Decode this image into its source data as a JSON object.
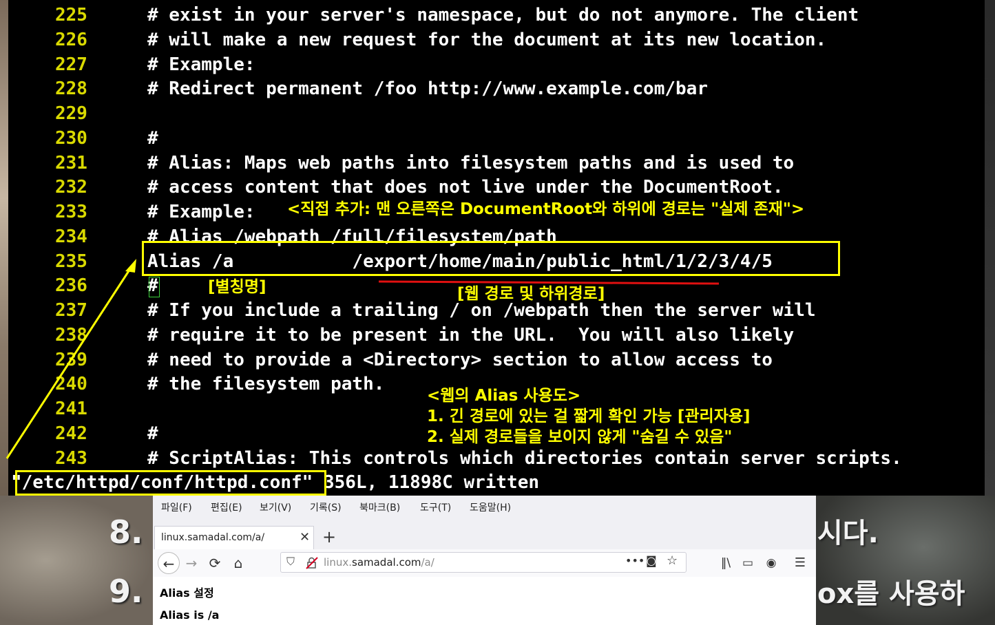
{
  "terminal": {
    "lines": [
      {
        "no": "225",
        "text": "# exist in your server's namespace, but do not anymore. The client"
      },
      {
        "no": "226",
        "text": "# will make a new request for the document at its new location."
      },
      {
        "no": "227",
        "text": "# Example:"
      },
      {
        "no": "228",
        "text": "# Redirect permanent /foo http://www.example.com/bar"
      },
      {
        "no": "229",
        "text": ""
      },
      {
        "no": "230",
        "text": "#"
      },
      {
        "no": "231",
        "text": "# Alias: Maps web paths into filesystem paths and is used to"
      },
      {
        "no": "232",
        "text": "# access content that does not live under the DocumentRoot."
      },
      {
        "no": "233",
        "text": "# Example:"
      },
      {
        "no": "234",
        "text": "# Alias /webpath /full/filesystem/path"
      },
      {
        "no": "235",
        "text": "Alias /a           /export/home/main/public_html/1/2/3/4/5"
      },
      {
        "no": "236",
        "text": "#"
      },
      {
        "no": "237",
        "text": "# If you include a trailing / on /webpath then the server will"
      },
      {
        "no": "238",
        "text": "# require it to be present in the URL.  You will also likely"
      },
      {
        "no": "239",
        "text": "# need to provide a <Directory> section to allow access to"
      },
      {
        "no": "240",
        "text": "# the filesystem path."
      },
      {
        "no": "241",
        "text": ""
      },
      {
        "no": "242",
        "text": "#"
      },
      {
        "no": "243",
        "text": "# ScriptAlias: This controls which directories contain server scripts."
      }
    ],
    "status": "\"/etc/httpd/conf/httpd.conf\" 356L, 11898C written"
  },
  "annotations": {
    "note_233": "<직접 추가: 맨 오른쪽은 DocumentRoot와 하위에 경로는 \"실제 존재\">",
    "alias_label": "[별칭명]",
    "path_label": "[웹 경로 및 하위경로]",
    "usage_title": "<웹의 Alias 사용도>",
    "usage_1": "1. 긴 경로에 있는 걸 짧게 확인 가능 [관리자용]",
    "usage_2": "2. 실제 경로들을 보이지 않게 \"숨길 수 있음\""
  },
  "background": {
    "num_8": "8.",
    "num_9": "9.",
    "right_text_1": "시다.",
    "right_text_2": "ox를 사용하"
  },
  "browser": {
    "menu": [
      "파일(F)",
      "편집(E)",
      "보기(V)",
      "기록(S)",
      "북마크(B)",
      "도구(T)",
      "도움말(H)"
    ],
    "tab_title": "linux.samadal.com/a/",
    "url_prefix": "linux.",
    "url_host": "samadal.com",
    "url_path": "/a/",
    "page_line_1": "Alias 설정",
    "page_line_2": "Alias is /a"
  },
  "colors": {
    "line_number": "#d9d900",
    "annotation": "#ffff00",
    "underline": "#e01010"
  }
}
